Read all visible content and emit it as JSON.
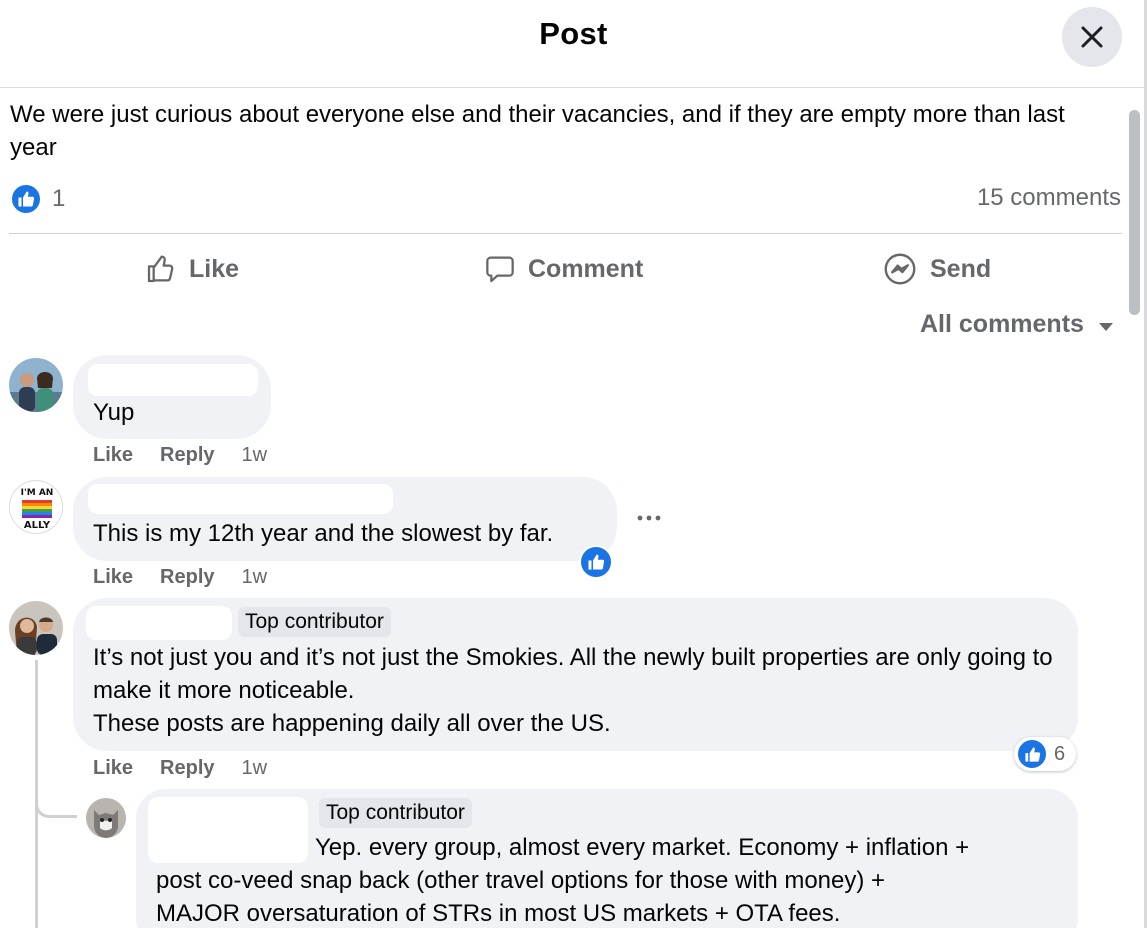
{
  "header": {
    "title": "Post"
  },
  "post": {
    "text": "We were just curious about everyone else and their vacancies, and if they are empty more than last year",
    "like_count": "1",
    "comments_count": "15 comments"
  },
  "actions": {
    "like": "Like",
    "comment": "Comment",
    "send": "Send"
  },
  "sort": {
    "label": "All comments"
  },
  "comments": [
    {
      "text": "Yup",
      "like": "Like",
      "reply": "Reply",
      "time": "1w"
    },
    {
      "text": "This is my 12th year and the slowest by far.",
      "like": "Like",
      "reply": "Reply",
      "time": "1w",
      "avatar_text": "I'M AN ALLY"
    },
    {
      "badge": "Top contributor",
      "text": "It’s not just you and it’s not just the Smokies. All the newly built properties are only going to make it more noticeable.\nThese posts are happening daily all over the US.",
      "like": "Like",
      "reply": "Reply",
      "time": "1w",
      "reaction_count": "6"
    },
    {
      "badge": "Top contributor",
      "text_line1": "Yep. every group, almost every market. Economy + inflation +",
      "text_rest": "post co-veed snap back (other travel options for those with money) +\nMAJOR oversaturation of STRs in most US markets + OTA fees."
    }
  ],
  "colors": {
    "accent": "#1b74e4",
    "bubble": "#f0f2f5",
    "muted": "#65676b"
  }
}
